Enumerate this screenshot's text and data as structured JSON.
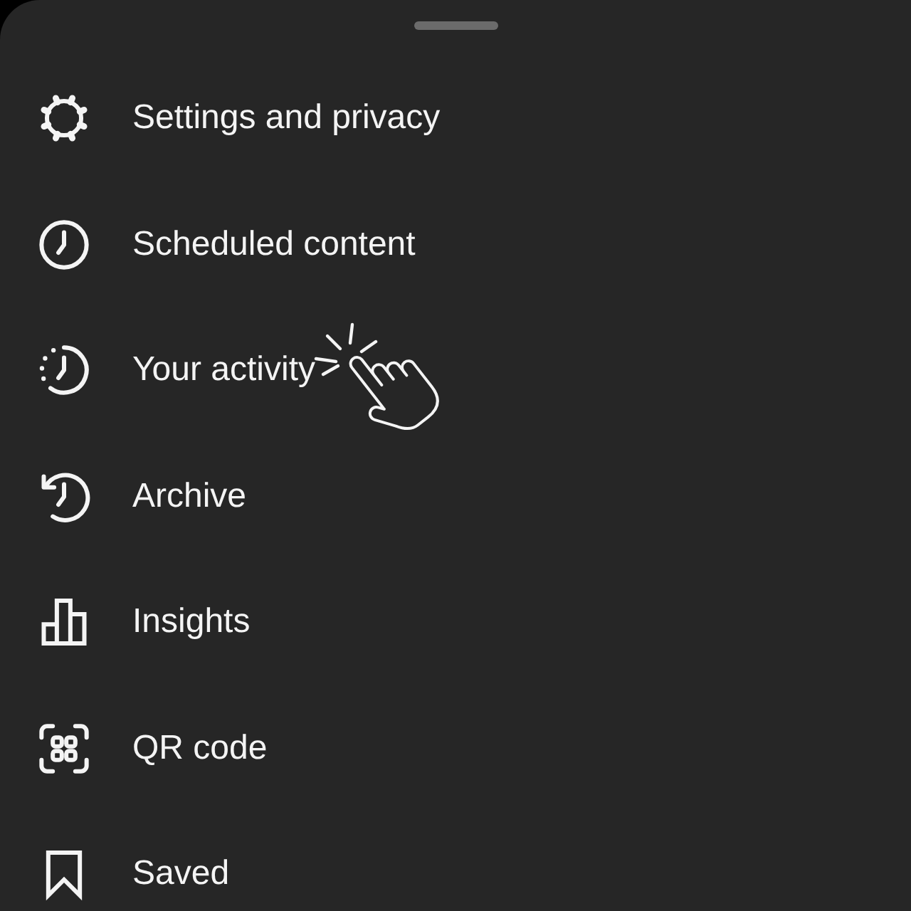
{
  "menu": {
    "items": [
      {
        "label": "Settings and privacy",
        "tapped": false
      },
      {
        "label": "Scheduled content",
        "tapped": false
      },
      {
        "label": "Your activity",
        "tapped": true
      },
      {
        "label": "Archive",
        "tapped": false
      },
      {
        "label": "Insights",
        "tapped": false
      },
      {
        "label": "QR code",
        "tapped": false
      },
      {
        "label": "Saved",
        "tapped": false
      }
    ]
  }
}
